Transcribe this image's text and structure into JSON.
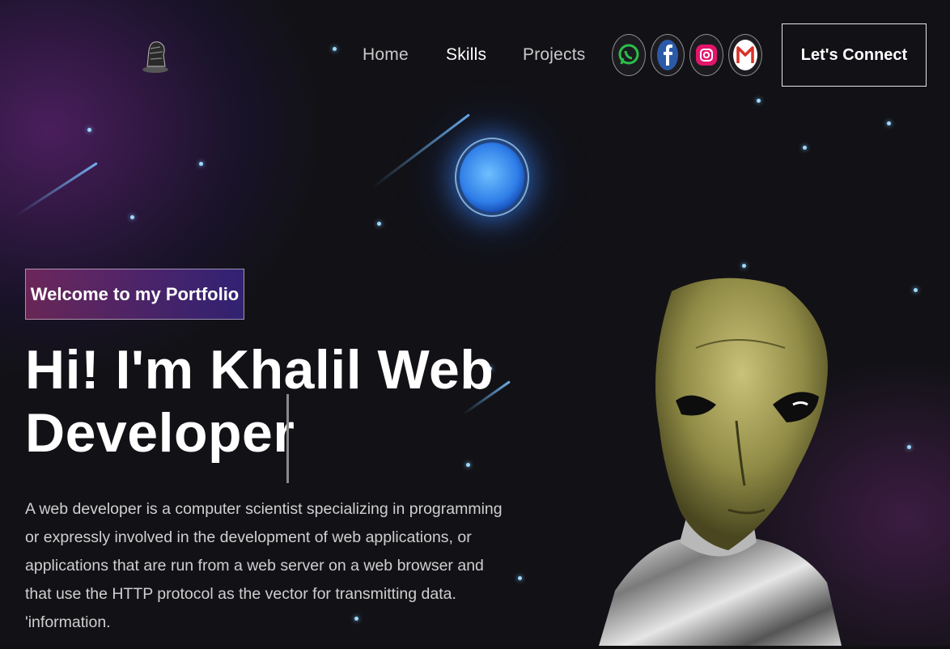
{
  "nav": {
    "links": [
      {
        "label": "Home"
      },
      {
        "label": "Skills"
      },
      {
        "label": "Projects"
      }
    ],
    "active": "Skills",
    "social": [
      {
        "icon": "whatsapp-icon",
        "color": "#2bbf4a"
      },
      {
        "icon": "facebook-icon",
        "color": "#2b5aa8"
      },
      {
        "icon": "instagram-icon",
        "color": "#e2156b"
      },
      {
        "icon": "gmail-icon",
        "color": "#d93025"
      }
    ],
    "connect_label": "Let's Connect"
  },
  "hero": {
    "tagline": "Welcome to my Portfolio",
    "headline": "Hi! I'm Khalil Web Developer",
    "description": "A web developer is a computer scientist specializing in programming or expressly involved in the development of web applications, or applications that are run from a web server on a web browser and that use the HTTP protocol as the vector for transmitting data. 'information."
  },
  "colors": {
    "background": "#121216",
    "tagline_gradient_start": "#aa367c",
    "tagline_gradient_end": "#4a2fbd",
    "planet": "#2f7ee8"
  }
}
